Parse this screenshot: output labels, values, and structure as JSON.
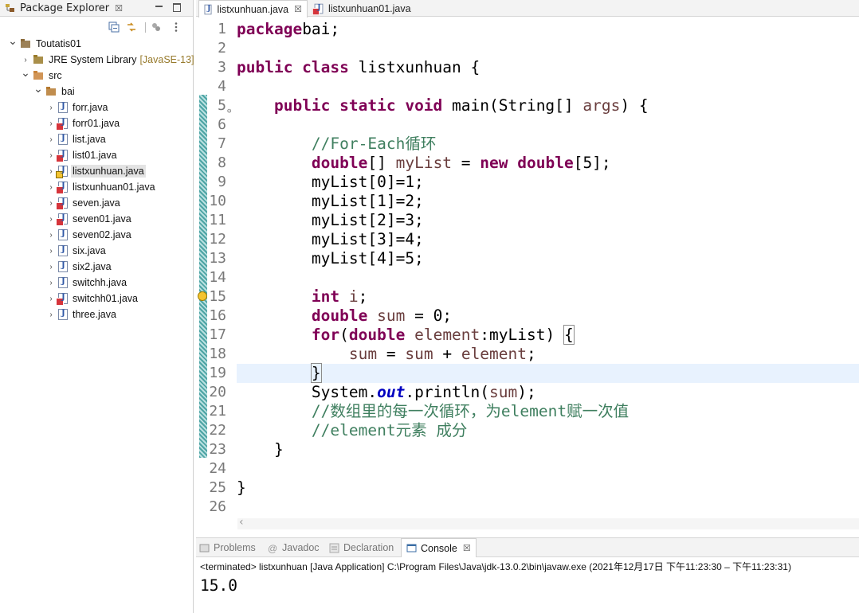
{
  "explorer": {
    "title": "Package Explorer",
    "tree": [
      {
        "label": "Toutatis01",
        "depth": 0,
        "twisty": "open",
        "icon": "project-icon"
      },
      {
        "label": "JRE System Library",
        "sub": "[JavaSE-13]",
        "depth": 1,
        "twisty": "closed",
        "icon": "library-icon"
      },
      {
        "label": "src",
        "depth": 1,
        "twisty": "open",
        "icon": "source-folder-icon"
      },
      {
        "label": "bai",
        "depth": 2,
        "twisty": "open",
        "icon": "package-icon"
      },
      {
        "label": "forr.java",
        "depth": 3,
        "twisty": "closed",
        "icon": "java-file-icon",
        "marker": ""
      },
      {
        "label": "forr01.java",
        "depth": 3,
        "twisty": "closed",
        "icon": "java-file-icon",
        "marker": "err"
      },
      {
        "label": "list.java",
        "depth": 3,
        "twisty": "closed",
        "icon": "java-file-icon",
        "marker": ""
      },
      {
        "label": "list01.java",
        "depth": 3,
        "twisty": "closed",
        "icon": "java-file-icon",
        "marker": "err"
      },
      {
        "label": "listxunhuan.java",
        "depth": 3,
        "twisty": "closed",
        "icon": "java-file-icon",
        "marker": "warn",
        "selected": true
      },
      {
        "label": "listxunhuan01.java",
        "depth": 3,
        "twisty": "closed",
        "icon": "java-file-icon",
        "marker": "err"
      },
      {
        "label": "seven.java",
        "depth": 3,
        "twisty": "closed",
        "icon": "java-file-icon",
        "marker": "err"
      },
      {
        "label": "seven01.java",
        "depth": 3,
        "twisty": "closed",
        "icon": "java-file-icon",
        "marker": "err"
      },
      {
        "label": "seven02.java",
        "depth": 3,
        "twisty": "closed",
        "icon": "java-file-icon",
        "marker": ""
      },
      {
        "label": "six.java",
        "depth": 3,
        "twisty": "closed",
        "icon": "java-file-icon",
        "marker": ""
      },
      {
        "label": "six2.java",
        "depth": 3,
        "twisty": "closed",
        "icon": "java-file-icon",
        "marker": ""
      },
      {
        "label": "switchh.java",
        "depth": 3,
        "twisty": "closed",
        "icon": "java-file-icon",
        "marker": ""
      },
      {
        "label": "switchh01.java",
        "depth": 3,
        "twisty": "closed",
        "icon": "java-file-icon",
        "marker": "err"
      },
      {
        "label": "three.java",
        "depth": 3,
        "twisty": "closed",
        "icon": "java-file-icon",
        "marker": ""
      }
    ]
  },
  "editor": {
    "tabs": [
      {
        "label": "listxunhuan.java",
        "active": true
      },
      {
        "label": "listxunhuan01.java",
        "active": false
      }
    ],
    "current_line": 19,
    "lines": [
      [
        [
          "kw",
          "package"
        ],
        [
          "",
          "bai;"
        ]
      ],
      [],
      [
        [
          "kw",
          "public class "
        ],
        [
          "",
          "listxunhuan {"
        ]
      ],
      [],
      [
        [
          "",
          "    "
        ],
        [
          "kw",
          "public static void "
        ],
        [
          "",
          "main(String[] "
        ],
        [
          "var",
          "args"
        ],
        [
          "",
          ") {"
        ]
      ],
      [],
      [
        [
          "",
          "        "
        ],
        [
          "cm",
          "//For-Each循环"
        ]
      ],
      [
        [
          "",
          "        "
        ],
        [
          "kw",
          "double"
        ],
        [
          "",
          "[] "
        ],
        [
          "var",
          "myList"
        ],
        [
          "",
          " = "
        ],
        [
          "kw",
          "new double"
        ],
        [
          "",
          "[5];"
        ]
      ],
      [
        [
          "",
          "        myList[0]=1;"
        ]
      ],
      [
        [
          "",
          "        myList[1]=2;"
        ]
      ],
      [
        [
          "",
          "        myList[2]=3;"
        ]
      ],
      [
        [
          "",
          "        myList[3]=4;"
        ]
      ],
      [
        [
          "",
          "        myList[4]=5;"
        ]
      ],
      [],
      [
        [
          "",
          "        "
        ],
        [
          "kw",
          "int "
        ],
        [
          "var",
          "i"
        ],
        [
          "",
          ";"
        ]
      ],
      [
        [
          "",
          "        "
        ],
        [
          "kw",
          "double "
        ],
        [
          "var",
          "sum"
        ],
        [
          "",
          " = 0;"
        ]
      ],
      [
        [
          "",
          "        "
        ],
        [
          "kw",
          "for"
        ],
        [
          "",
          "("
        ],
        [
          "kw",
          "double "
        ],
        [
          "var",
          "element"
        ],
        [
          "",
          ":myList) "
        ],
        [
          "box",
          "{"
        ]
      ],
      [
        [
          "",
          "            "
        ],
        [
          "var",
          "sum"
        ],
        [
          "",
          " = "
        ],
        [
          "var",
          "sum"
        ],
        [
          "",
          " + "
        ],
        [
          "var",
          "element"
        ],
        [
          "",
          ";"
        ]
      ],
      [
        [
          "",
          "        "
        ],
        [
          "box",
          "}"
        ],
        [
          "caret",
          ""
        ]
      ],
      [
        [
          "",
          "        System."
        ],
        [
          "fld",
          "out"
        ],
        [
          "",
          ".println("
        ],
        [
          "var",
          "sum"
        ],
        [
          "",
          ");"
        ]
      ],
      [
        [
          "",
          "        "
        ],
        [
          "cm",
          "//数组里的每一次循环，为element赋一次值"
        ]
      ],
      [
        [
          "",
          "        "
        ],
        [
          "cm",
          "//element元素 成分"
        ]
      ],
      [
        [
          "",
          "    }"
        ]
      ],
      [],
      [
        [
          "",
          "}"
        ]
      ],
      []
    ]
  },
  "bottom": {
    "tabs": [
      {
        "label": "Problems",
        "icon": "problems-icon",
        "active": false
      },
      {
        "label": "Javadoc",
        "icon": "at-icon",
        "active": false
      },
      {
        "label": "Declaration",
        "icon": "declaration-icon",
        "active": false
      },
      {
        "label": "Console",
        "icon": "console-icon",
        "active": true
      }
    ],
    "status": "<terminated> listxunhuan [Java Application] C:\\Program Files\\Java\\jdk-13.0.2\\bin\\javaw.exe  (2021年12月17日 下午11:23:30 – 下午11:23:31)",
    "output": "15.0"
  },
  "colors": {
    "keyword": "#7f0055",
    "comment": "#3f7f5f",
    "field": "#0000c0",
    "variable": "#6a3e3e",
    "current_line": "#e8f2fe"
  }
}
